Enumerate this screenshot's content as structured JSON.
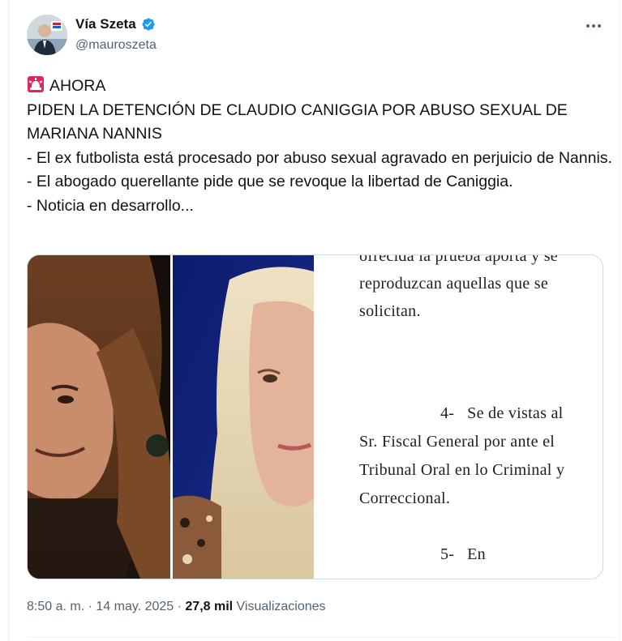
{
  "author": {
    "display_name": "Vía Szeta",
    "handle": "@mauroszeta",
    "verified": true,
    "avatar_icon": "profile-photo",
    "verified_color": "#1d9bf0"
  },
  "tweet": {
    "lines": [
      "AHORA",
      "PIDEN LA DETENCIÓN DE CLAUDIO CANIGGIA POR ABUSO SEXUAL DE MARIANA NANNIS",
      "- El ex futbolista está procesado por abuso sexual agravado en perjuicio de Nannis.",
      "- El abogado querellante pide que se revoque la libertad de Caniggia.",
      "- Noticia en desarrollo..."
    ],
    "emoji_icon": "rotating-light-icon"
  },
  "document": {
    "lines": [
      "ofrecida la prueba aporta y se",
      "reproduzcan aquellas que se",
      "solicitan.",
      "4-   Se de vistas al",
      "Sr. Fiscal General por ante el",
      "Tribunal Oral en lo Criminal y",
      "Correccional.",
      "5-   En"
    ]
  },
  "meta": {
    "time": "8:50 a. m.",
    "separator": "·",
    "date": "14 may. 2025",
    "views_count": "27,8 mil",
    "views_label": "Visualizaciones"
  },
  "colors": {
    "text": "#0f1419",
    "secondary": "#536471",
    "border": "#cfd9de"
  }
}
